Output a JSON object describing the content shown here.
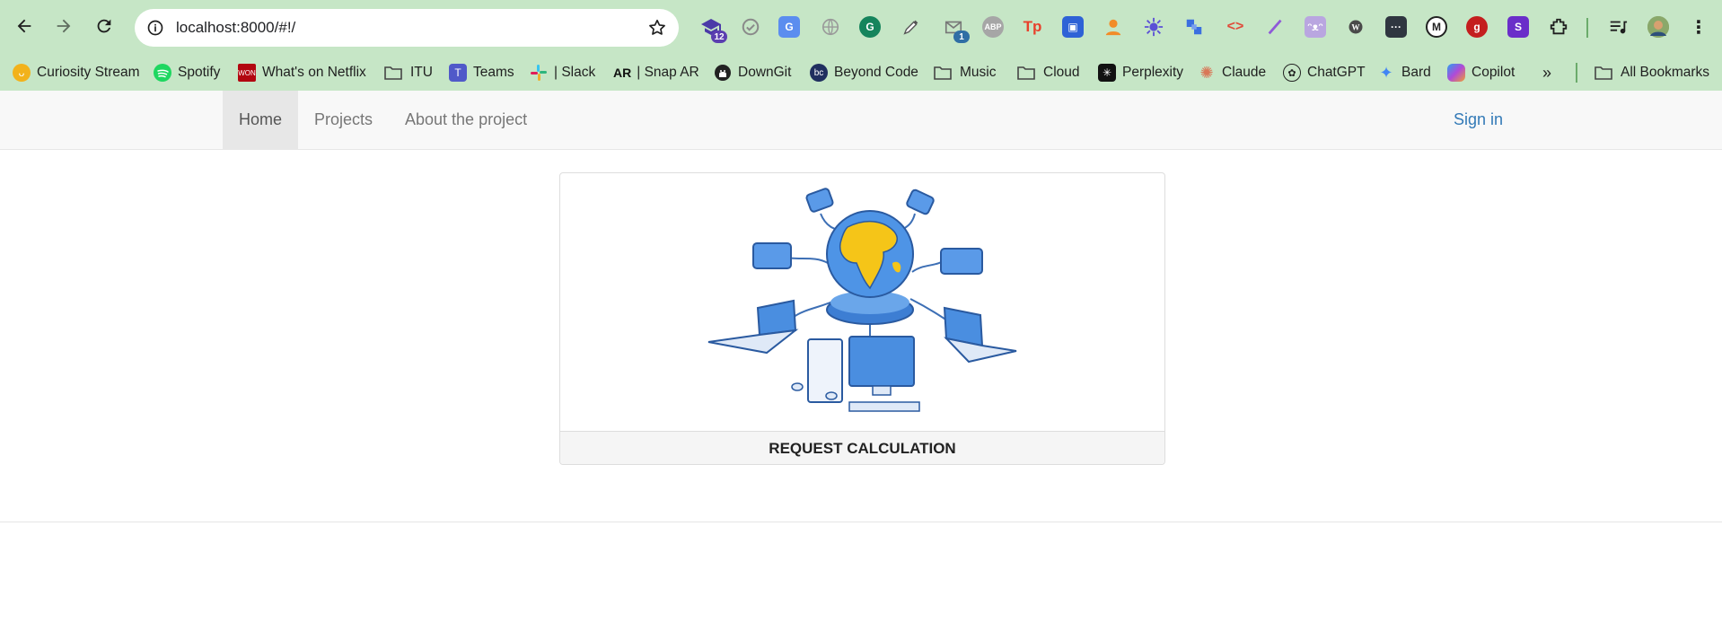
{
  "browser": {
    "url": "localhost:8000/#!/",
    "extension_badges": {
      "graduation": "12",
      "mail": "1"
    },
    "extensions": [
      "graduation-cap-icon",
      "check-circle-icon",
      "translate-icon",
      "globe-icon",
      "grammarly-icon",
      "eyedropper-icon",
      "mail-icon",
      "adblock-icon",
      "tp-icon",
      "docs-icon",
      "person-icon",
      "sun-gear-icon",
      "puzzle-blocks-icon",
      "code-icon",
      "pen-icon",
      "cat-icon",
      "wordpress-icon",
      "dots-icon",
      "medium-icon",
      "g-icon",
      "s-icon",
      "extensions-icon",
      "media-icon",
      "profile-avatar",
      "more-icon"
    ]
  },
  "bookmarks": [
    {
      "label": "Curiosity Stream",
      "icon": "curiosity-icon",
      "color": "#f2b21b"
    },
    {
      "label": "Spotify",
      "icon": "spotify-icon",
      "color": "#1ed760"
    },
    {
      "label": "What's on Netflix",
      "icon": "won-icon",
      "color": "#b20710"
    },
    {
      "label": "ITU",
      "icon": "folder-icon"
    },
    {
      "label": "Teams",
      "icon": "teams-icon",
      "color": "#5059c9"
    },
    {
      "label": "| Slack",
      "icon": "slack-icon"
    },
    {
      "label": "| Snap AR",
      "icon": "snap-ar-icon"
    },
    {
      "label": "DownGit",
      "icon": "github-icon"
    },
    {
      "label": "Beyond Code",
      "icon": "beyond-code-icon",
      "color": "#1f2f5f"
    },
    {
      "label": "Music",
      "icon": "folder-icon"
    },
    {
      "label": "Cloud",
      "icon": "folder-icon"
    },
    {
      "label": "Perplexity",
      "icon": "perplexity-icon",
      "color": "#111111"
    },
    {
      "label": "Claude",
      "icon": "claude-icon",
      "color": "#d97757"
    },
    {
      "label": "ChatGPT",
      "icon": "chatgpt-icon"
    },
    {
      "label": "Bard",
      "icon": "bard-icon",
      "color": "#4285f4"
    },
    {
      "label": "Copilot",
      "icon": "copilot-icon"
    }
  ],
  "bookmarks_all": "All Bookmarks",
  "snap_ar_logo": "AR",
  "beyond_code_logo": "bc",
  "won_logo": "WON",
  "navbar": {
    "home": "Home",
    "projects": "Projects",
    "about": "About the project",
    "sign_in": "Sign in"
  },
  "card": {
    "image": "network-globe-illustration",
    "footer_label": "REQUEST CALCULATION"
  },
  "colors": {
    "chrome": "#c6e6c6",
    "link": "#337ab7",
    "navbar_bg": "#f8f8f8"
  }
}
